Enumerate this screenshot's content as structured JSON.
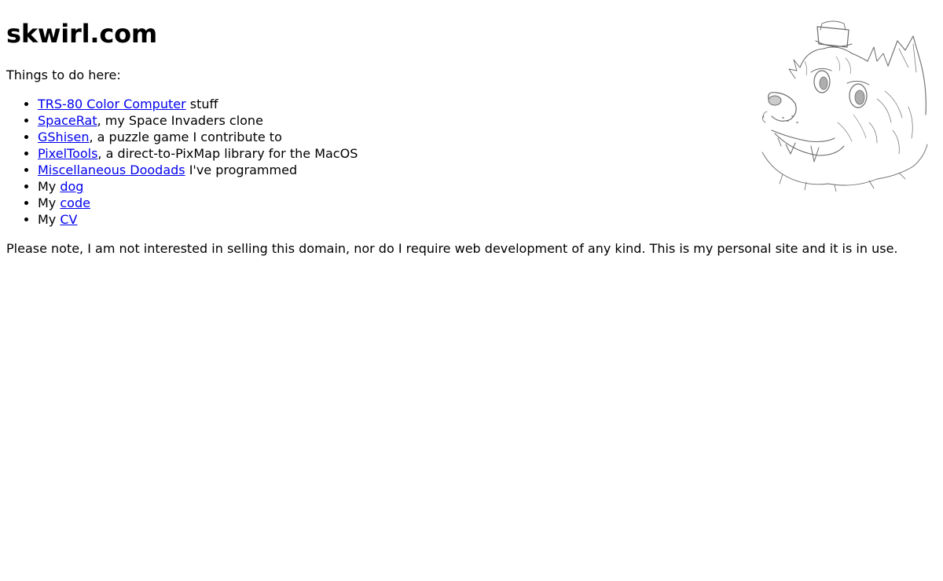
{
  "site": {
    "title": "skwirl.com",
    "intro": "Things to do here:"
  },
  "items": [
    {
      "prefix": "",
      "link": "TRS-80 Color Computer",
      "suffix": " stuff"
    },
    {
      "prefix": "",
      "link": "SpaceRat",
      "suffix": ", my Space Invaders clone"
    },
    {
      "prefix": "",
      "link": "GShisen",
      "suffix": ", a puzzle game I contribute to"
    },
    {
      "prefix": "",
      "link": "PixelTools",
      "suffix": ", a direct-to-PixMap library for the MacOS"
    },
    {
      "prefix": "",
      "link": "Miscellaneous Doodads",
      "suffix": " I've programmed"
    },
    {
      "prefix": "My ",
      "link": "dog",
      "suffix": ""
    },
    {
      "prefix": "My ",
      "link": "code",
      "suffix": ""
    },
    {
      "prefix": "My ",
      "link": "CV",
      "suffix": ""
    }
  ],
  "note": "Please note, I am not interested in selling this domain, nor do I require web development of any kind. This is my personal site and it is in use.",
  "colors": {
    "link": "#0000ee",
    "text": "#000000",
    "background": "#ffffff",
    "sketch": "#6b6b6b"
  },
  "images": {
    "mascot": "dog-sketch-illustration"
  }
}
